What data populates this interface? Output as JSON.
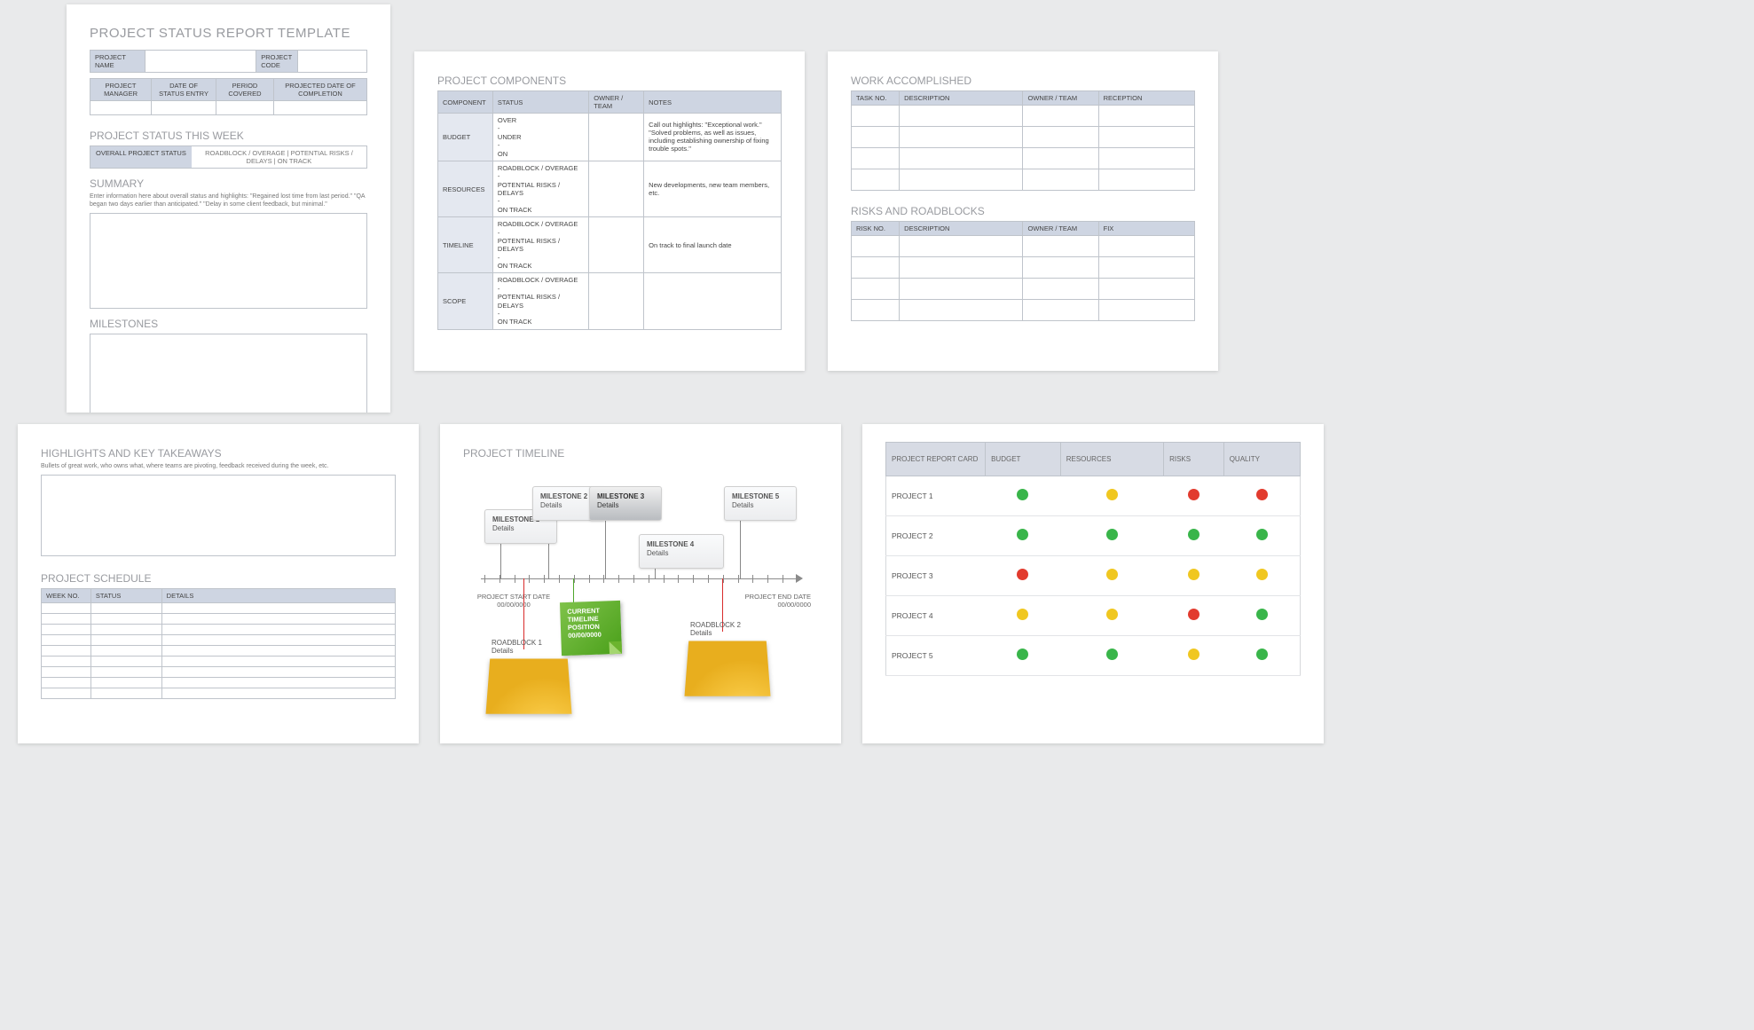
{
  "p1": {
    "title": "PROJECT STATUS REPORT TEMPLATE",
    "hdr1": [
      "PROJECT NAME",
      "PROJECT CODE"
    ],
    "hdr2": [
      "PROJECT MANAGER",
      "DATE OF STATUS ENTRY",
      "PERIOD COVERED",
      "PROJECTED DATE OF COMPLETION"
    ],
    "status_title": "PROJECT STATUS THIS WEEK",
    "status_label": "OVERALL PROJECT STATUS",
    "status_opts": "ROADBLOCK / OVERAGE   |   POTENTIAL RISKS / DELAYS   |   ON TRACK",
    "summary_title": "SUMMARY",
    "summary_help": "Enter information here about overall status and highlights: \"Regained lost time from last period.\" \"QA began two days earlier than anticipated.\" \"Delay in some client feedback, but minimal.\"",
    "milestones_title": "MILESTONES"
  },
  "p2": {
    "title": "PROJECT COMPONENTS",
    "cols": [
      "COMPONENT",
      "STATUS",
      "OWNER / TEAM",
      "NOTES"
    ],
    "rows": [
      {
        "c": "BUDGET",
        "s": "OVER\n-\nUNDER\n-\nON",
        "n": "Call out highlights: \"Exceptional work.\" \"Solved problems, as well as issues, including establishing ownership of fixing trouble spots.\""
      },
      {
        "c": "RESOURCES",
        "s": "ROADBLOCK / OVERAGE\n-\nPOTENTIAL RISKS / DELAYS\n-\nON TRACK",
        "n": "New developments, new team members, etc."
      },
      {
        "c": "TIMELINE",
        "s": "ROADBLOCK / OVERAGE\n-\nPOTENTIAL RISKS / DELAYS\n-\nON TRACK",
        "n": "On track to final launch date"
      },
      {
        "c": "SCOPE",
        "s": "ROADBLOCK / OVERAGE\n-\nPOTENTIAL RISKS / DELAYS\n-\nON TRACK",
        "n": ""
      }
    ]
  },
  "p3": {
    "t1": "WORK ACCOMPLISHED",
    "c1": [
      "TASK NO.",
      "DESCRIPTION",
      "OWNER / TEAM",
      "RECEPTION"
    ],
    "t2": "RISKS AND ROADBLOCKS",
    "c2": [
      "RISK NO.",
      "DESCRIPTION",
      "OWNER / TEAM",
      "FIX"
    ]
  },
  "p4": {
    "t1": "HIGHLIGHTS AND KEY TAKEAWAYS",
    "h1": "Bullets of great work, who owns what, where teams are pivoting, feedback received during the week, etc.",
    "t2": "PROJECT SCHEDULE",
    "cols": [
      "WEEK NO.",
      "STATUS",
      "DETAILS"
    ]
  },
  "p5": {
    "title": "PROJECT TIMELINE",
    "ms": [
      {
        "t": "MILESTONE 1",
        "d": "Details"
      },
      {
        "t": "MILESTONE 2",
        "d": "Details"
      },
      {
        "t": "MILESTONE 3",
        "d": "Details"
      },
      {
        "t": "MILESTONE 4",
        "d": "Details"
      },
      {
        "t": "MILESTONE 5",
        "d": "Details"
      }
    ],
    "start_l": "PROJECT START DATE",
    "start_d": "00/00/0000",
    "end_l": "PROJECT END DATE",
    "end_d": "00/00/0000",
    "cur1": "CURRENT",
    "cur2": "TIMELINE",
    "cur3": "POSITION",
    "cur4": "00/00/0000",
    "rb1": "ROADBLOCK 1",
    "rb1d": "Details",
    "rb2": "ROADBLOCK 2",
    "rb2d": "Details"
  },
  "p6": {
    "title": "PROJECT REPORT CARD",
    "cols": [
      "BUDGET",
      "RESOURCES",
      "RISKS",
      "QUALITY"
    ],
    "rows": [
      {
        "n": "PROJECT 1",
        "v": [
          "g",
          "y",
          "r",
          "r"
        ]
      },
      {
        "n": "PROJECT 2",
        "v": [
          "g",
          "g",
          "g",
          "g"
        ]
      },
      {
        "n": "PROJECT 3",
        "v": [
          "r",
          "y",
          "y",
          "y"
        ]
      },
      {
        "n": "PROJECT 4",
        "v": [
          "y",
          "y",
          "r",
          "g"
        ]
      },
      {
        "n": "PROJECT 5",
        "v": [
          "g",
          "g",
          "y",
          "g"
        ]
      }
    ]
  }
}
